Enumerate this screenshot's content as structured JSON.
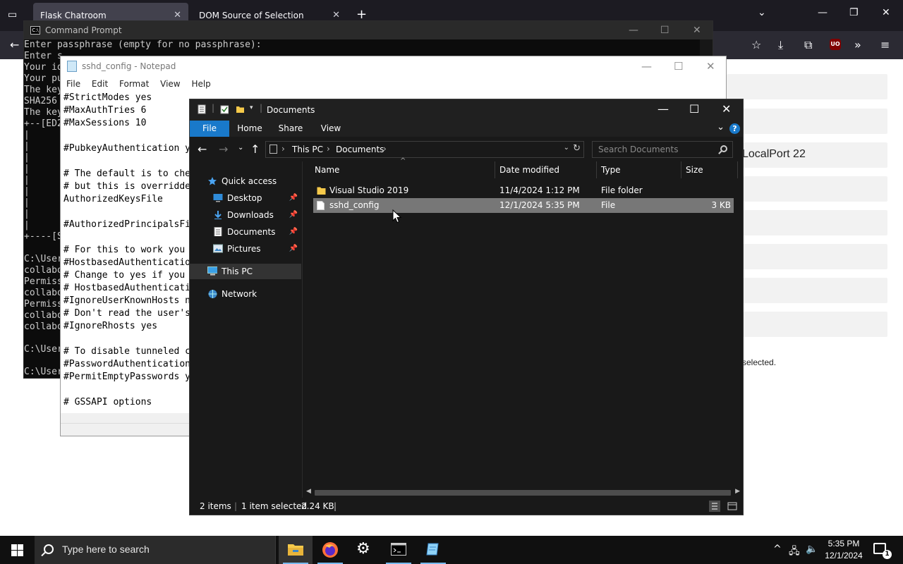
{
  "browser": {
    "tabs": [
      {
        "label": "Flask Chatroom"
      },
      {
        "label": "DOM Source of Selection"
      }
    ],
    "page": {
      "localport_text": "LocalPort 22",
      "selected_text": "selected."
    }
  },
  "cmd": {
    "title": "Command Prompt",
    "lines": [
      "Enter passphrase (empty for no passphrase):",
      "Enter s",
      "Your id",
      "Your pu",
      "The key",
      "SHA256",
      "The key",
      "+--[ED2",
      "|",
      "|",
      "|",
      "|",
      "|",
      "|",
      "|",
      "|",
      "|",
      "+----[S",
      "",
      "C:\\User",
      "collabo",
      "Permiss",
      "collabo",
      "Permiss",
      "collabo",
      "collabo",
      "",
      "C:\\User",
      "",
      "C:\\User"
    ]
  },
  "notepad": {
    "title": "sshd_config - Notepad",
    "menu": [
      "File",
      "Edit",
      "Format",
      "View",
      "Help"
    ],
    "lines": [
      "#StrictModes yes",
      "#MaxAuthTries 6",
      "#MaxSessions 10",
      "",
      "#PubkeyAuthentication yes",
      "",
      "# The default is to check",
      "# but this is overridden",
      "AuthorizedKeysFile",
      "",
      "#AuthorizedPrincipalsFile",
      "",
      "# For this to work you",
      "#HostbasedAuthentication",
      "# Change to yes if you",
      "# HostbasedAuthenticatio",
      "#IgnoreUserKnownHosts n",
      "# Don't read the user's",
      "#IgnoreRhosts yes",
      "",
      "# To disable tunneled c",
      "#PasswordAuthentication",
      "#PermitEmptyPasswords y",
      "",
      "# GSSAPI options"
    ]
  },
  "explorer": {
    "title": "Documents",
    "ribbon_tabs": [
      "File",
      "Home",
      "Share",
      "View"
    ],
    "help": "?",
    "breadcrumb": [
      "This PC",
      "Documents"
    ],
    "search_placeholder": "Search Documents",
    "nav": {
      "quick_access": "Quick access",
      "desktop": "Desktop",
      "downloads": "Downloads",
      "documents": "Documents",
      "pictures": "Pictures",
      "this_pc": "This PC",
      "network": "Network"
    },
    "columns": [
      "Name",
      "Date modified",
      "Type",
      "Size"
    ],
    "rows": [
      {
        "name": "Visual Studio 2019",
        "date": "11/4/2024 1:12 PM",
        "type": "File folder",
        "size": ""
      },
      {
        "name": "sshd_config",
        "date": "12/1/2024 5:35 PM",
        "type": "File",
        "size": "3 KB"
      }
    ],
    "status": {
      "items": "2 items",
      "selected": "1 item selected",
      "size": "2.24 KB"
    }
  },
  "taskbar": {
    "search_text": "Type here to search",
    "time": "5:35 PM",
    "date": "12/1/2024",
    "notif_count": "1"
  },
  "colors": {
    "accent": "#1979ca",
    "explorer_bg": "#191919",
    "selection": "#777777",
    "folder": "#f5c94a"
  }
}
